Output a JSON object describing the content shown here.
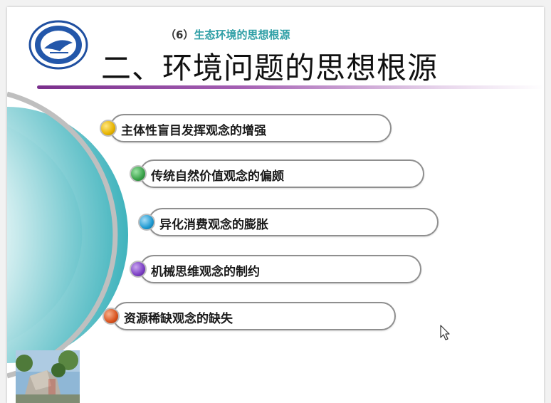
{
  "slide": {
    "subtitle_num": "（6）",
    "subtitle_text": "生态环境的思想根源",
    "title": "二、环境问题的思想根源"
  },
  "items": [
    {
      "label": "主体性盲目发挥观念的增强",
      "color": "#e7b400"
    },
    {
      "label": "传统自然价值观念的偏颇",
      "color": "#3aa24a"
    },
    {
      "label": "异化消费观念的膨胀",
      "color": "#1e9ad2"
    },
    {
      "label": "机械思维观念的制约",
      "color": "#7b3fc4"
    },
    {
      "label": "资源稀缺观念的缺失",
      "color": "#d9531e"
    }
  ],
  "colors": {
    "accent_purple": "#7a2f8c",
    "logo_blue": "#1f4fa0",
    "teal": "#3fb6bf"
  },
  "icons": {
    "logo": "university-seal-icon",
    "cursor": "mouse-pointer-icon"
  }
}
